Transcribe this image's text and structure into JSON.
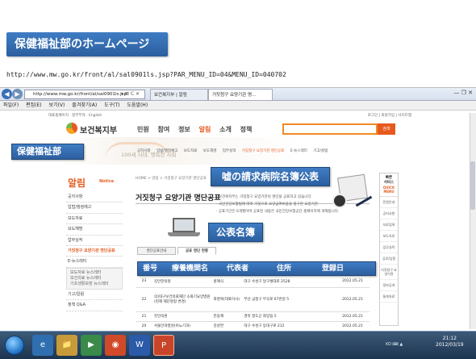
{
  "slide": {
    "title": "保健福祉部のホームページ",
    "url": "http://www.mw.go.kr/front/al/sal0901ls.jsp?PAR_MENU_ID=04&MENU_ID=040702"
  },
  "browser": {
    "address": "http://www.mw.go.kr/front/al/sal0901ls.jsp",
    "address_icons": "▾ ⊠ C ✕",
    "tabs": [
      "보건복지부 | 알림",
      "거짓청구 요양기관 명..."
    ],
    "menu": [
      "파일(F)",
      "편집(E)",
      "보기(V)",
      "즐겨찾기(A)",
      "도구(T)",
      "도움말(H)"
    ],
    "window_controls": "— ❐ ✕"
  },
  "site": {
    "logo_text": "보건복지부",
    "util_left": "대표홈페이지 · 정부부처 · English",
    "util_right": "로그인 | 회원가입 | 사이트맵",
    "gnb": [
      "민원",
      "참여",
      "정보",
      "알림",
      "소개",
      "정책"
    ],
    "gnb_selected": "알림",
    "search_button": "검색",
    "slogan": "100세 시대,\n행복한 사회",
    "subnav": [
      "공지사항",
      "입법/행정예고",
      "보도자료",
      "보도해명",
      "업무실적",
      "거짓청구 요양기관 명단공표",
      "E-뉴스레터",
      "기고/칼럼"
    ],
    "subnav_selected": "거짓청구 요양기관 명단공표"
  },
  "left_menu": {
    "title": "알림",
    "subtitle": "Notice",
    "items": [
      "공지사항",
      "입법/행정예고",
      "보도자료",
      "보도해명",
      "업무실적",
      "거짓청구 요양기관 명단공표",
      "E-뉴스레터"
    ],
    "highlight_index": 5,
    "sub_box": "보도자료 뉴스레터\n보건의료 뉴스레터\n기초생활보장 뉴스레터",
    "after_items": [
      "기고/칼럼",
      "정책 Q&A"
    ]
  },
  "content": {
    "breadcrumb": "HOME > 알림 > 거짓청구 요양기관 명단공표",
    "heading": "거짓청구 요양기관 명단공표",
    "bullets": [
      "· 보건복지부는 거짓청구 요양기관의 명단을 공표하고 있습니다.",
      "· 국민건강보험법에 따라 거짓으로 요양급여비용을 청구한 요양기관",
      "· 공표기간은 6개월이며 공표된 내용은 국민건강보험공단 홈페이지에 게재됩니다."
    ],
    "tabs": [
      "명단공표안내",
      "공표 명단 현황"
    ],
    "active_tab": 1,
    "rows": [
      {
        "no": "23",
        "name": "김안한의원",
        "rep": "홍혜식",
        "addr": "대구 수성구 달구벌대로 2528",
        "date": "2012.05.21"
      },
      {
        "no": "22",
        "name": "의)대구보건의료재단 소화기요양병원 (현재 재단명칭 변경)",
        "rep": "최영복(대표이사)",
        "addr": "부산 금정구 부곡로 67번길 5",
        "date": "2012.05.21"
      },
      {
        "no": "21",
        "name": "진안의원",
        "rep": "진용재",
        "addr": "경북 청도군 화양읍 5",
        "date": "2012.05.21"
      },
      {
        "no": "20",
        "name": "서울안과병원(비뇨기과)",
        "rep": "김성연",
        "addr": "대구 수성구 동대구로 212",
        "date": "2012.05.21"
      }
    ]
  },
  "quick_menu": {
    "title": "빠른\n서비스",
    "subtitle": "QUICK\nMENU",
    "items": [
      "민원안내",
      "공지사항",
      "자료검색",
      "보도자료",
      "업무실적",
      "공모/입찰",
      "거짓청구 요양기관",
      "정보공개",
      "통계자료"
    ]
  },
  "taskbar": {
    "apps": [
      "e",
      "📁",
      "▶",
      "◉",
      "W",
      "P"
    ],
    "tray": "KO  ⌨  ▲",
    "time": "21:12",
    "date": "2012/03/19"
  },
  "overlays": {
    "ministry": "保健福祉部",
    "rumor": "嘘の請求病院名簿公表",
    "list": "公表名簿",
    "header": {
      "no": "番号",
      "name": "療養機関名",
      "rep": "代表者",
      "addr": "住所",
      "date": "登録日"
    }
  }
}
